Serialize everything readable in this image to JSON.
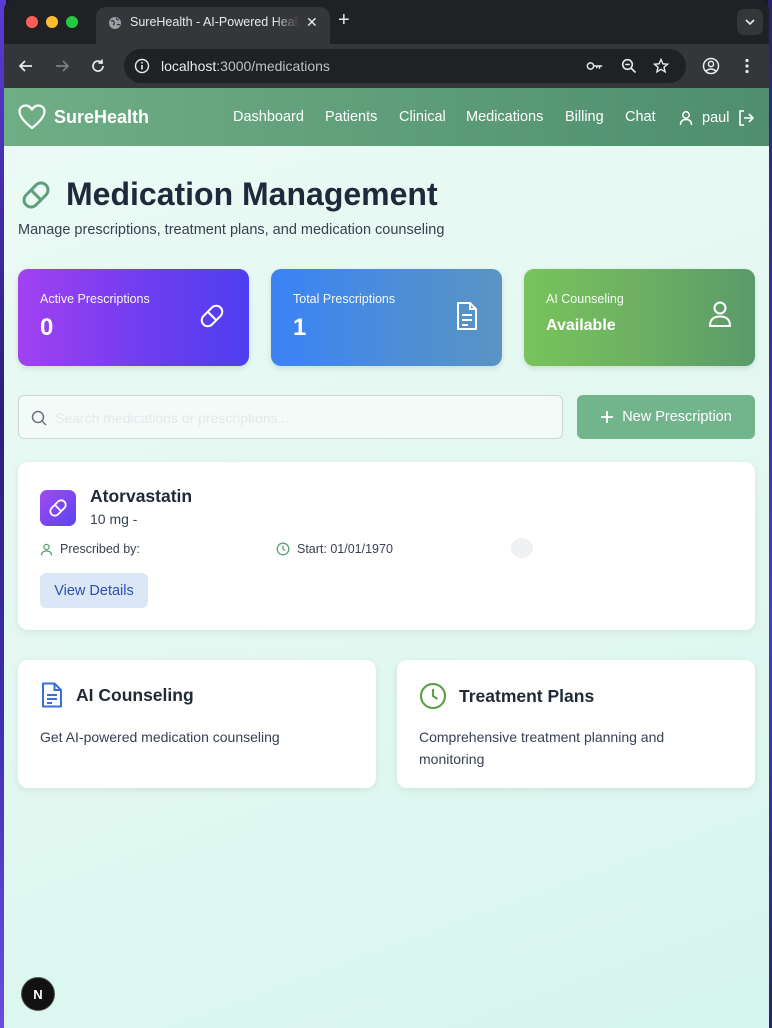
{
  "browser": {
    "tab_title": "SureHealth - AI-Powered Healthcare",
    "url_host": "localhost",
    "url_path": ":3000/medications"
  },
  "app": {
    "brand": "SureHealth",
    "nav": [
      "Dashboard",
      "Patients",
      "Clinical",
      "Medications",
      "Billing",
      "Chat"
    ],
    "user": "paul"
  },
  "page": {
    "title": "Medication Management",
    "subtitle": "Manage prescriptions, treatment plans, and medication counseling"
  },
  "stats": [
    {
      "label": "Active Prescriptions",
      "value": "0",
      "color": "#7a3ff0",
      "icon": "pill-icon"
    },
    {
      "label": "Total Prescriptions",
      "value": "1",
      "color": "#4a8ad8",
      "icon": "document-icon"
    },
    {
      "label": "AI Counseling",
      "value": "Available",
      "color": "#6db062",
      "icon": "user-icon"
    }
  ],
  "search": {
    "placeholder": "Search medications or prescriptions..."
  },
  "new_prescription_label": "New Prescription",
  "prescriptions": [
    {
      "name": "Atorvastatin",
      "dose": "10 mg -",
      "prescribed_by": "Prescribed by:",
      "start": "Start: 01/01/1970",
      "action": "View Details"
    }
  ],
  "features": [
    {
      "title": "AI Counseling",
      "desc": "Get AI-powered medication counseling",
      "icon": "document-icon"
    },
    {
      "title": "Treatment Plans",
      "desc": "Comprehensive treatment planning and monitoring",
      "icon": "clock-icon"
    }
  ],
  "dev_badge": "N",
  "colors": {
    "nav_bg": "#5f9e7c",
    "accent_green": "#72b48c",
    "title": "#1e293b"
  }
}
